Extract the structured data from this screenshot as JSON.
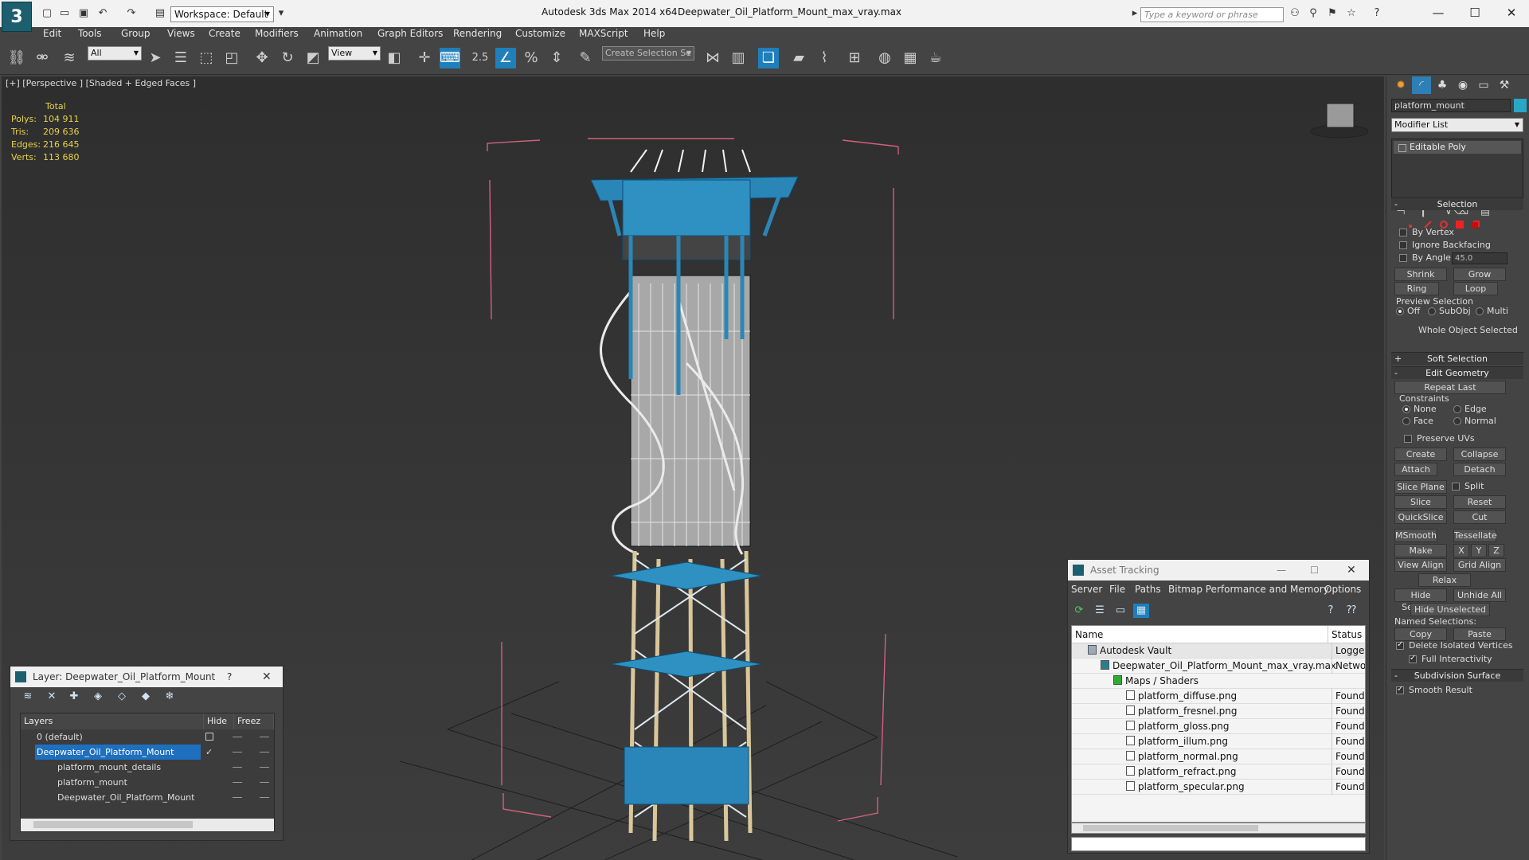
{
  "window": {
    "app_title": "Autodesk 3ds Max  2014 x64",
    "file_title": "Deepwater_Oil_Platform_Mount_max_vray.max",
    "workspace_label": "Workspace: Default",
    "search_placeholder": "Type a keyword or phrase"
  },
  "menu": [
    "Edit",
    "Tools",
    "Group",
    "Views",
    "Create",
    "Modifiers",
    "Animation",
    "Graph Editors",
    "Rendering",
    "Customize",
    "MAXScript",
    "Help"
  ],
  "toolbar": {
    "filter_value": "All",
    "coord_value": "View",
    "selection_set": "Create Selection Se",
    "snap_label": "2.5"
  },
  "viewport": {
    "label": "[+] [Perspective ] [Shaded + Edged Faces ]",
    "stats": {
      "header": "Total",
      "rows": [
        {
          "k": "Polys:",
          "v": "104 911"
        },
        {
          "k": "Tris:",
          "v": "209 636"
        },
        {
          "k": "Edges:",
          "v": "216 645"
        },
        {
          "k": "Verts:",
          "v": "113 680"
        }
      ]
    }
  },
  "command_panel": {
    "object_name": "platform_mount",
    "object_color": "#2aa6c7",
    "modifier_list": "Modifier List",
    "stack_item": "Editable Poly",
    "selection": {
      "title": "Selection",
      "by_vertex": "By Vertex",
      "ignore_backfacing": "Ignore Backfacing",
      "by_angle": "By Angle:",
      "angle_value": "45.0",
      "shrink": "Shrink",
      "grow": "Grow",
      "ring": "Ring",
      "loop": "Loop",
      "preview_selection": "Preview Selection",
      "off": "Off",
      "subobj": "SubObj",
      "multi": "Multi",
      "whole_object": "Whole Object Selected"
    },
    "soft_selection": "Soft Selection",
    "edit_geometry": {
      "title": "Edit Geometry",
      "repeat_last": "Repeat Last",
      "constraints": "Constraints",
      "none": "None",
      "edge": "Edge",
      "face": "Face",
      "normal": "Normal",
      "preserve_uvs": "Preserve UVs",
      "create": "Create",
      "collapse": "Collapse",
      "attach": "Attach",
      "detach": "Detach",
      "slice_plane": "Slice Plane",
      "split": "Split",
      "slice": "Slice",
      "reset_plane": "Reset Plane",
      "quickslice": "QuickSlice",
      "cut": "Cut",
      "msmooth": "MSmooth",
      "tessellate": "Tessellate",
      "make_planar": "Make Planar",
      "x": "X",
      "y": "Y",
      "z": "Z",
      "view_align": "View Align",
      "grid_align": "Grid Align",
      "relax": "Relax",
      "hide_selected": "Hide Selected",
      "unhide_all": "Unhide All",
      "hide_unselected": "Hide Unselected",
      "named_selections": "Named Selections:",
      "copy": "Copy",
      "paste": "Paste",
      "delete_isolated": "Delete Isolated Vertices",
      "full_interactivity": "Full Interactivity"
    },
    "subdivision_surface": {
      "title": "Subdivision Surface",
      "smooth_result": "Smooth Result"
    }
  },
  "layer_explorer": {
    "title": "Layer: Deepwater_Oil_Platform_Mount",
    "help": "?",
    "col_layers": "Layers",
    "col_hide": "Hide",
    "col_freeze": "Freez",
    "rows": [
      {
        "name": "0 (default)",
        "indent": 0,
        "selected": false
      },
      {
        "name": "Deepwater_Oil_Platform_Mount",
        "indent": 0,
        "selected": true
      },
      {
        "name": "platform_mount_details",
        "indent": 1,
        "selected": false
      },
      {
        "name": "platform_mount",
        "indent": 1,
        "selected": false
      },
      {
        "name": "Deepwater_Oil_Platform_Mount",
        "indent": 1,
        "selected": false
      }
    ]
  },
  "asset_tracking": {
    "title": "Asset Tracking",
    "menu": [
      "Server",
      "File",
      "Paths",
      "Bitmap Performance and Memory",
      "Options"
    ],
    "col_name": "Name",
    "col_status": "Status",
    "rows": [
      {
        "name": "Autodesk Vault",
        "status": "Logged O",
        "indent": 1
      },
      {
        "name": "Deepwater_Oil_Platform_Mount_max_vray.max",
        "status": "Network",
        "indent": 2
      },
      {
        "name": "Maps / Shaders",
        "status": "",
        "indent": 3
      },
      {
        "name": "platform_diffuse.png",
        "status": "Found",
        "indent": 4
      },
      {
        "name": "platform_fresnel.png",
        "status": "Found",
        "indent": 4
      },
      {
        "name": "platform_gloss.png",
        "status": "Found",
        "indent": 4
      },
      {
        "name": "platform_illum.png",
        "status": "Found",
        "indent": 4
      },
      {
        "name": "platform_normal.png",
        "status": "Found",
        "indent": 4
      },
      {
        "name": "platform_refract.png",
        "status": "Found",
        "indent": 4
      },
      {
        "name": "platform_specular.png",
        "status": "Found",
        "indent": 4
      }
    ]
  }
}
